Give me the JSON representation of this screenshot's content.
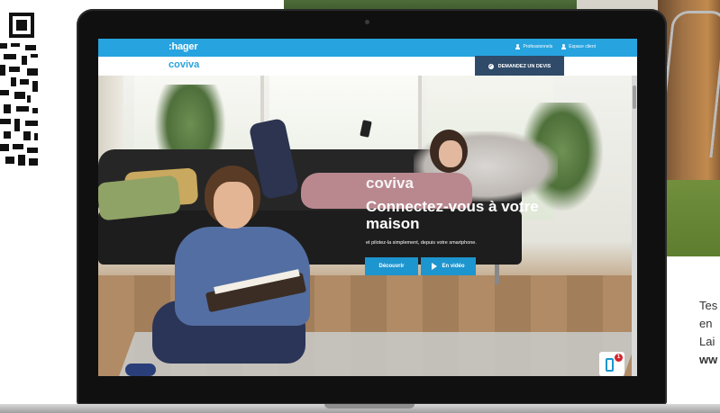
{
  "header": {
    "brand": ":hager",
    "links": [
      {
        "label": "Professionnels"
      },
      {
        "label": "Espace client"
      }
    ]
  },
  "subheader": {
    "product": "coviva",
    "cta_label": "DEMANDEZ UN DEVIS"
  },
  "hero": {
    "brand": "coviva",
    "title": "Connectez-vous à votre maison",
    "subtitle": "et pilotez-la simplement, depuis votre smartphone.",
    "buttons": [
      {
        "label": "Découvrir"
      },
      {
        "label": "En vidéo"
      }
    ]
  },
  "widget": {
    "badge_count": "1"
  },
  "side_text": {
    "lines": [
      "Tes",
      "en",
      "Lai",
      "ww"
    ]
  },
  "colors": {
    "brand_blue": "#27a3df",
    "cta_navy": "#2f4b69",
    "button_blue": "#1d95cf",
    "badge_red": "#d6252d"
  }
}
